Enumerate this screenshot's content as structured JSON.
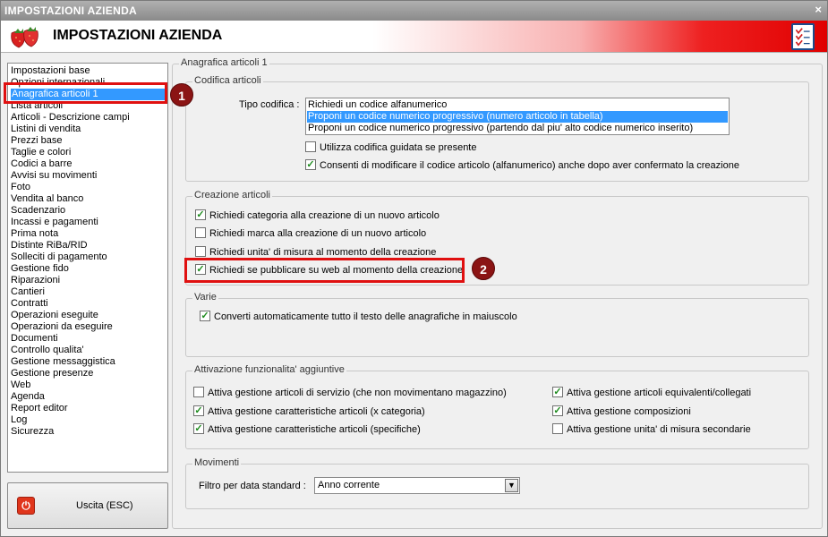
{
  "window": {
    "title": "IMPOSTAZIONI AZIENDA",
    "close_glyph": "×"
  },
  "header": {
    "title": "IMPOSTAZIONI AZIENDA"
  },
  "sidebar": {
    "items": [
      "Impostazioni base",
      "Opzioni internazionali",
      "Anagrafica articoli 1",
      "Lista articoli",
      "Articoli - Descrizione campi",
      "Listini di vendita",
      "Prezzi base",
      "Taglie e colori",
      "Codici a barre",
      "Avvisi su movimenti",
      "Foto",
      "Vendita al banco",
      "Scadenzario",
      "Incassi e pagamenti",
      "Prima nota",
      "Distinte RiBa/RID",
      "Solleciti di pagamento",
      "Gestione fido",
      "Riparazioni",
      "Cantieri",
      "Contratti",
      "Operazioni eseguite",
      "Operazioni da eseguire",
      "Documenti",
      "Controllo qualita'",
      "Gestione messaggistica",
      "Gestione presenze",
      "Web",
      "Agenda",
      "Report editor",
      "Log",
      "Sicurezza"
    ],
    "selected_index": 2,
    "exit_label": "Uscita (ESC)"
  },
  "main": {
    "title": "Anagrafica articoli 1",
    "codifica": {
      "legend": "Codifica articoli",
      "tipo_label": "Tipo codifica :",
      "options": [
        "Richiedi un codice alfanumerico",
        "Proponi un codice numerico progressivo (numero articolo in tabella)",
        "Proponi un codice numerico progressivo (partendo dal piu' alto codice numerico inserito)"
      ],
      "selected_index": 1,
      "checkboxes": [
        {
          "label": "Utilizza codifica guidata se presente",
          "checked": false
        },
        {
          "label": "Consenti di modificare il codice articolo (alfanumerico) anche dopo aver confermato la creazione",
          "checked": true
        }
      ]
    },
    "creazione": {
      "legend": "Creazione articoli",
      "checkboxes": [
        {
          "label": "Richiedi categoria alla creazione di un nuovo articolo",
          "checked": true
        },
        {
          "label": "Richiedi marca alla creazione di un nuovo articolo",
          "checked": false
        },
        {
          "label": "Richiedi unita' di misura al momento della creazione",
          "checked": false
        },
        {
          "label": "Richiedi se pubblicare su web al momento della creazione",
          "checked": true
        }
      ]
    },
    "varie": {
      "legend": "Varie",
      "checkboxes": [
        {
          "label": "Converti automaticamente tutto il testo delle anagrafiche in maiuscolo",
          "checked": true
        }
      ]
    },
    "attivazione": {
      "legend": "Attivazione funzionalita' aggiuntive",
      "left": [
        {
          "label": "Attiva gestione articoli di servizio (che non movimentano magazzino)",
          "checked": false
        },
        {
          "label": "Attiva gestione caratteristiche articoli (x categoria)",
          "checked": true
        },
        {
          "label": "Attiva gestione caratteristiche articoli (specifiche)",
          "checked": true
        }
      ],
      "right": [
        {
          "label": "Attiva gestione articoli equivalenti/collegati",
          "checked": true
        },
        {
          "label": "Attiva gestione composizioni",
          "checked": true
        },
        {
          "label": "Attiva gestione unita' di misura secondarie",
          "checked": false
        }
      ]
    },
    "movimenti": {
      "legend": "Movimenti",
      "filter_label": "Filtro per data standard :",
      "filter_value": "Anno corrente"
    }
  },
  "annotations": {
    "badge1": "1",
    "badge2": "2"
  },
  "icons": {
    "check_glyph": "✓",
    "dropdown": "▼",
    "power": "⏻"
  },
  "colors": {
    "selection": "#3399ff",
    "highlight": "#e01010",
    "badge": "#8b1414"
  }
}
